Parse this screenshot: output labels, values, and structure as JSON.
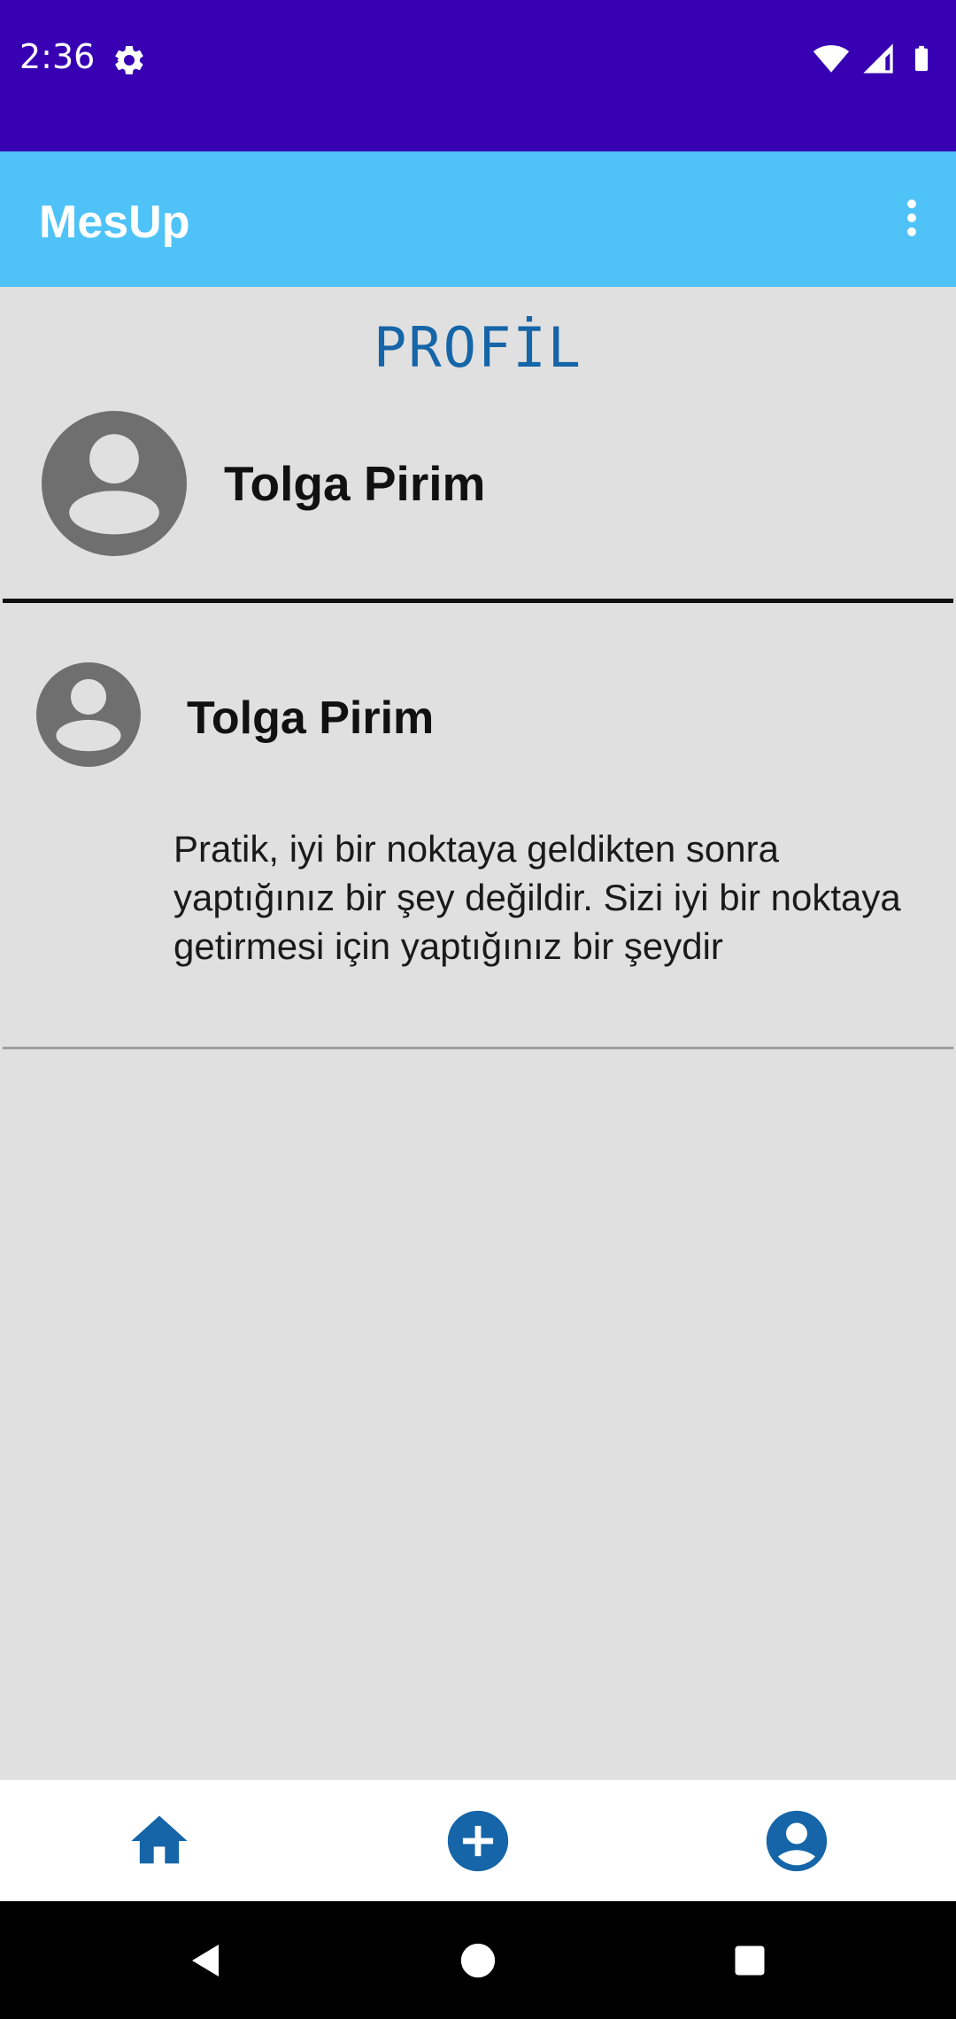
{
  "status_bar": {
    "time": "2:36",
    "background": "#3700b3",
    "icons": [
      "gear-icon",
      "wifi-icon",
      "signal-icon",
      "battery-icon"
    ]
  },
  "app_bar": {
    "title": "MesUp",
    "background": "#4fc3f7",
    "menu_icon": "more-vert-icon"
  },
  "profile": {
    "heading": "PROFİL",
    "name": "Tolga Pirim",
    "avatar_icon": "account-circle-icon"
  },
  "posts": [
    {
      "author": "Tolga Pirim",
      "text": "Pratik, iyi bir noktaya geldikten sonra yaptığınız bir şey değildir. Sizi iyi bir noktaya getirmesi için yaptığınız bir şeydir",
      "avatar_icon": "account-circle-icon"
    }
  ],
  "bottom_nav": {
    "items": [
      {
        "icon": "home-icon"
      },
      {
        "icon": "add-circle-icon"
      },
      {
        "icon": "account-circle-icon"
      }
    ],
    "accent": "#1565a8"
  },
  "system_nav": {
    "buttons": [
      "back-icon",
      "home-circle-icon",
      "recents-icon"
    ]
  }
}
